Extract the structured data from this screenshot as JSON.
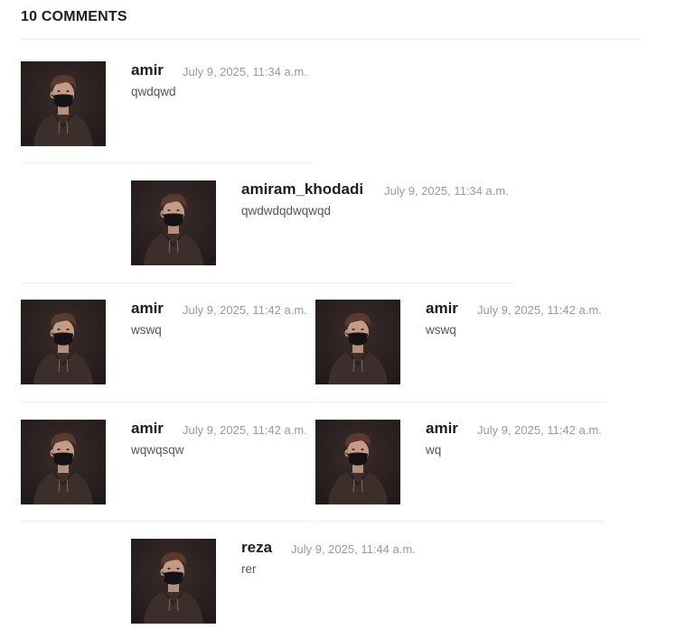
{
  "heading": "10 COMMENTS",
  "avatar_icon": "user-avatar-icon",
  "colors": {
    "avatar_bg": "#2a2020",
    "date": "#9a9a9a",
    "author": "#1d1d1d"
  },
  "comments": [
    {
      "author": "amir",
      "date": "July 9, 2025, 11:34 a.m.",
      "text": "qwdqwd"
    },
    {
      "author": "amiram_khodadi",
      "date": "July 9, 2025, 11:34 a.m.",
      "text": "qwdwdqdwqwqd"
    },
    {
      "author": "amir",
      "date": "July 9, 2025, 11:42 a.m.",
      "text": "wswq"
    },
    {
      "author": "amir",
      "date": "July 9, 2025, 11:42 a.m.",
      "text": "wswq"
    },
    {
      "author": "amir",
      "date": "July 9, 2025, 11:42 a.m.",
      "text": "wqwqsqw"
    },
    {
      "author": "amir",
      "date": "July 9, 2025, 11:42 a.m.",
      "text": "wq"
    },
    {
      "author": "reza",
      "date": "July 9, 2025, 11:44 a.m.",
      "text": "rer"
    }
  ]
}
